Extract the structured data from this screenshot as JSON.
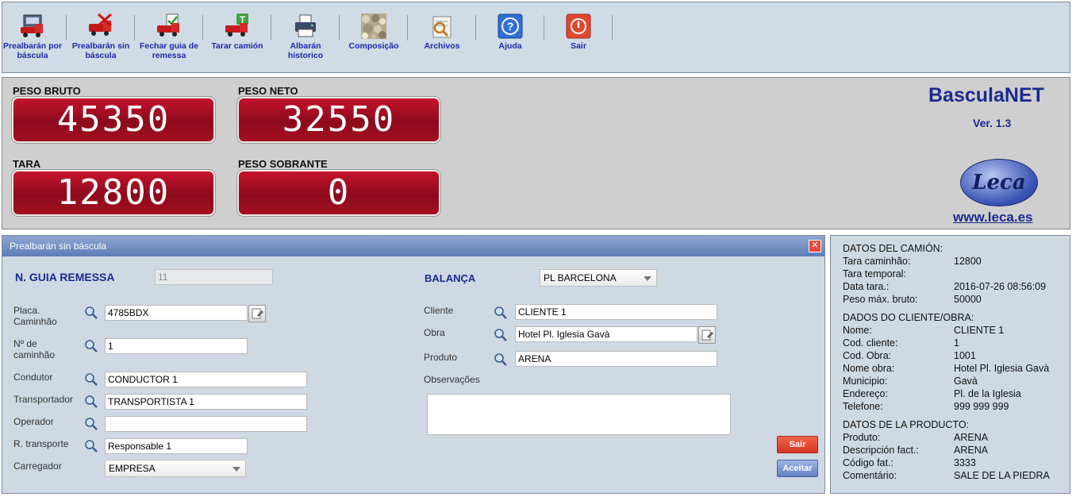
{
  "toolbar": {
    "items": [
      {
        "label": "Prealbarán por báscula",
        "icon": "truck-scale-icon"
      },
      {
        "label": "Prealbarán sin báscula",
        "icon": "truck-no-scale-icon"
      },
      {
        "label": "Fechar guia de remessa",
        "icon": "truck-check-icon"
      },
      {
        "label": "Tarar camión",
        "icon": "truck-tare-icon"
      },
      {
        "label": "Albarán historico",
        "icon": "printer-icon"
      },
      {
        "label": "Composição",
        "icon": "aggregate-icon"
      },
      {
        "label": "Archivos",
        "icon": "archive-icon"
      },
      {
        "label": "Ajuda",
        "icon": "help-icon"
      },
      {
        "label": "Sair",
        "icon": "power-icon"
      }
    ]
  },
  "scale": {
    "peso_bruto_label": "PESO BRUTO",
    "peso_bruto": "45350",
    "peso_neto_label": "PESO NETO",
    "peso_neto": "32550",
    "tara_label": "TARA",
    "tara": "12800",
    "peso_sobrante_label": "PESO SOBRANTE",
    "peso_sobrante": "0",
    "brand": "BasculaNET",
    "version": "Ver. 1.3",
    "logo_text": "Leca",
    "website": "www.leca.es"
  },
  "dialog": {
    "title": "Prealbarán sin báscula",
    "guia_label": "N. GUIA REMESSA",
    "guia_value": "11",
    "balanca_label": "BALANÇA",
    "balanca_value": "PL BARCELONA",
    "placa_label": "Placa. Caminhão",
    "placa_value": "4785BDX",
    "num_caminhao_label": "Nº de caminhão",
    "num_caminhao_value": "1",
    "condutor_label": "Condutor",
    "condutor_value": "CONDUCTOR 1",
    "transportador_label": "Transportador",
    "transportador_value": "TRANSPORTISTA 1",
    "operador_label": "Operador",
    "operador_value": "",
    "r_transporte_label": "R. transporte",
    "r_transporte_value": "Responsable 1",
    "carregador_label": "Carregador",
    "carregador_value": "EMPRESA",
    "cliente_label": "Cliente",
    "cliente_value": "CLIENTE 1",
    "obra_label": "Obra",
    "obra_value": "Hotel Pl. Iglesia Gavà",
    "produto_label": "Produto",
    "produto_value": "ARENA",
    "observacoes_label": "Observações",
    "observacoes_value": "",
    "sair_label": "Sair",
    "aceitar_label": "Aceitar"
  },
  "info": {
    "camiao_header": "DATOS DEL CAMIÓN:",
    "camiao_rows": [
      {
        "label": "Tara caminhão:",
        "value": "12800"
      },
      {
        "label": "Tara temporal:",
        "value": ""
      },
      {
        "label": "Data tara.:",
        "value": "2016-07-26 08:56:09"
      },
      {
        "label": "Peso máx. bruto:",
        "value": "50000"
      }
    ],
    "cliente_header": "DADOS DO CLIENTE/OBRA:",
    "cliente_rows": [
      {
        "label": "Nome:",
        "value": "CLIENTE 1"
      },
      {
        "label": "Cod. cliente:",
        "value": "1"
      },
      {
        "label": "Cod. Obra:",
        "value": "1001"
      },
      {
        "label": "Nome obra:",
        "value": "Hotel Pl. Iglesia Gavà"
      },
      {
        "label": "Municipio:",
        "value": "Gavà"
      },
      {
        "label": "Endereço:",
        "value": "Pl. de la Iglesia"
      },
      {
        "label": "Telefone:",
        "value": "999 999 999"
      }
    ],
    "produto_header": "DATOS DE LA PRODUCTO:",
    "produto_rows": [
      {
        "label": "Produto:",
        "value": "ARENA"
      },
      {
        "label": "Descripción fact.:",
        "value": "ARENA"
      },
      {
        "label": "Código fat.:",
        "value": "3333"
      },
      {
        "label": "Comentário:",
        "value": "SALE DE LA PIEDRA"
      }
    ]
  },
  "colors": {
    "display_red": "#a5101f",
    "brand_blue": "#1b2a8e",
    "panel_bg": "#cfd9e4",
    "sair_btn": "#e2422d",
    "aceitar_btn": "#6f8fcf"
  }
}
